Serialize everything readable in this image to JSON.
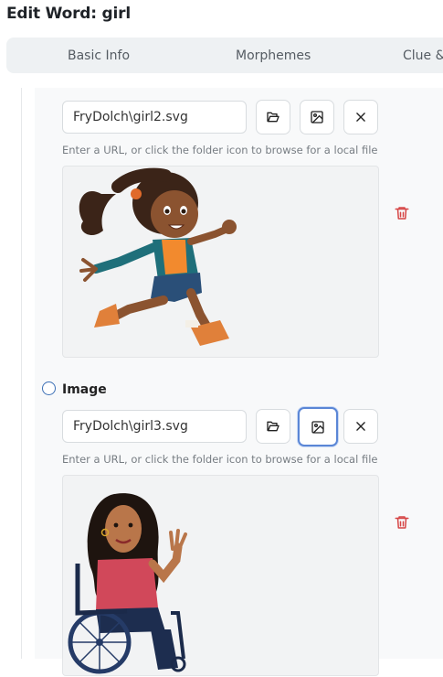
{
  "page": {
    "title": "Edit Word: girl"
  },
  "tabs": [
    {
      "label": "Basic Info"
    },
    {
      "label": "Morphemes"
    },
    {
      "label": "Clue &"
    }
  ],
  "images": [
    {
      "path": "FryDolch\\girl2.svg",
      "hint": "Enter a URL, or click the folder icon to browse for a local file"
    },
    {
      "label": "Image",
      "path": "FryDolch\\girl3.svg",
      "hint": "Enter a URL, or click the folder icon to browse for a local file"
    }
  ],
  "icons": {
    "browse": "folder-open-icon",
    "preview": "image-icon",
    "clear": "close-icon",
    "delete": "trash-icon"
  },
  "colors": {
    "accent": "#3b6fb5",
    "delete": "#d64545",
    "tab_bg": "#eef1f3"
  }
}
